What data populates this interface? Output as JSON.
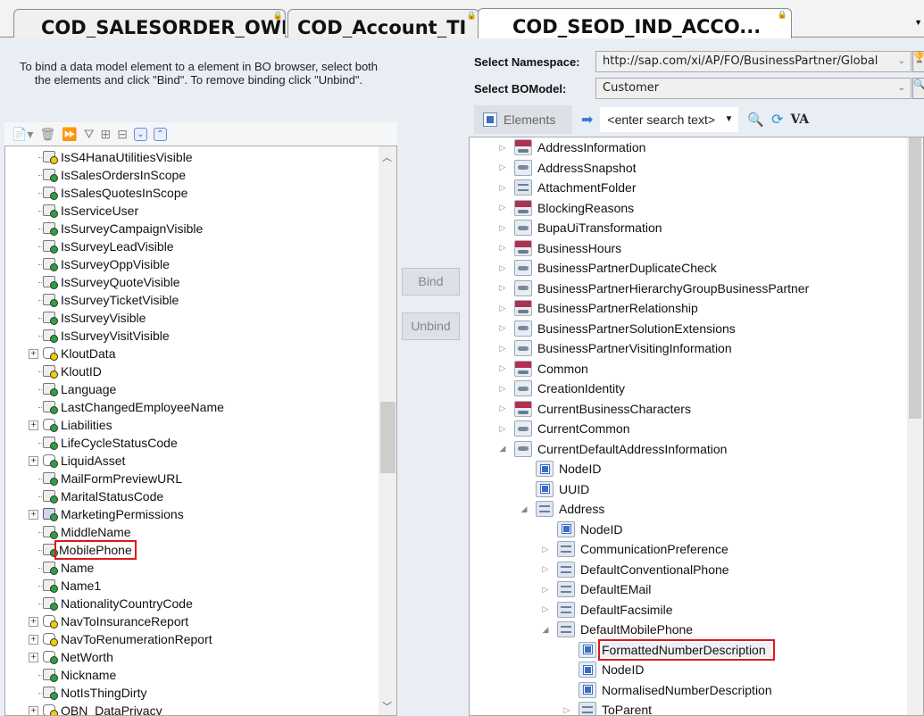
{
  "tabs": [
    {
      "label": "COD_SALESORDER_OWL",
      "locked": true
    },
    {
      "label": "COD_Account_TI",
      "locked": true
    },
    {
      "label": "COD_SEOD_IND_ACCO...",
      "locked": true,
      "active": true
    }
  ],
  "instructions": "To bind a data model element to a element in BO browser, select both the elements and click \"Bind\". To remove binding click \"Unbind\".",
  "buttons": {
    "bind": "Bind",
    "unbind": "Unbind"
  },
  "namespace": {
    "label": "Select Namespace:",
    "value": "http://sap.com/xi/AP/FO/BusinessPartner/Global"
  },
  "bomodel": {
    "label": "Select BOModel:",
    "value": "Customer"
  },
  "elements_button": "Elements",
  "search": {
    "placeholder": "<enter search text>"
  },
  "va_label": "VA",
  "left_tree": [
    {
      "name": "IsS4HanaUtilitiesVisible",
      "icon": "field",
      "status": "yellow"
    },
    {
      "name": "IsSalesOrdersInScope",
      "icon": "field",
      "status": "green"
    },
    {
      "name": "IsSalesQuotesInScope",
      "icon": "field",
      "status": "green"
    },
    {
      "name": "IsServiceUser",
      "icon": "field",
      "status": "green"
    },
    {
      "name": "IsSurveyCampaignVisible",
      "icon": "field",
      "status": "green"
    },
    {
      "name": "IsSurveyLeadVisible",
      "icon": "field",
      "status": "green"
    },
    {
      "name": "IsSurveyOppVisible",
      "icon": "field",
      "status": "green"
    },
    {
      "name": "IsSurveyQuoteVisible",
      "icon": "field",
      "status": "green"
    },
    {
      "name": "IsSurveyTicketVisible",
      "icon": "field",
      "status": "green"
    },
    {
      "name": "IsSurveyVisible",
      "icon": "field",
      "status": "green"
    },
    {
      "name": "IsSurveyVisitVisible",
      "icon": "field",
      "status": "green"
    },
    {
      "name": "KloutData",
      "icon": "node",
      "status": "yellow",
      "expandable": true
    },
    {
      "name": "KloutID",
      "icon": "field",
      "status": "yellow"
    },
    {
      "name": "Language",
      "icon": "field",
      "status": "green"
    },
    {
      "name": "LastChangedEmployeeName",
      "icon": "field",
      "status": "green"
    },
    {
      "name": "Liabilities",
      "icon": "node",
      "status": "green",
      "expandable": true
    },
    {
      "name": "LifeCycleStatusCode",
      "icon": "field",
      "status": "green"
    },
    {
      "name": "LiquidAsset",
      "icon": "node",
      "status": "green",
      "expandable": true
    },
    {
      "name": "MailFormPreviewURL",
      "icon": "field",
      "status": "green"
    },
    {
      "name": "MaritalStatusCode",
      "icon": "field",
      "status": "green"
    },
    {
      "name": "MarketingPermissions",
      "icon": "table",
      "status": "green",
      "expandable": true
    },
    {
      "name": "MiddleName",
      "icon": "field",
      "status": "green"
    },
    {
      "name": "MobilePhone",
      "icon": "field",
      "status": "green",
      "highlighted": true
    },
    {
      "name": "Name",
      "icon": "field",
      "status": "green"
    },
    {
      "name": "Name1",
      "icon": "field",
      "status": "green"
    },
    {
      "name": "NationalityCountryCode",
      "icon": "field",
      "status": "green"
    },
    {
      "name": "NavToInsuranceReport",
      "icon": "node",
      "status": "yellow",
      "expandable": true
    },
    {
      "name": "NavToRenumerationReport",
      "icon": "node",
      "status": "yellow",
      "expandable": true
    },
    {
      "name": "NetWorth",
      "icon": "node",
      "status": "green",
      "expandable": true
    },
    {
      "name": "Nickname",
      "icon": "field",
      "status": "green"
    },
    {
      "name": "NotIsThingDirty",
      "icon": "field",
      "status": "green"
    },
    {
      "name": "OBN_DataPrivacy",
      "icon": "node",
      "status": "yellow",
      "expandable": true
    }
  ],
  "right_tree": [
    {
      "name": "AddressInformation",
      "depth": 0,
      "expander": "collapsed",
      "icon": "assoc-red"
    },
    {
      "name": "AddressSnapshot",
      "depth": 0,
      "expander": "collapsed",
      "icon": "assoc"
    },
    {
      "name": "AttachmentFolder",
      "depth": 0,
      "expander": "collapsed",
      "icon": "node"
    },
    {
      "name": "BlockingReasons",
      "depth": 0,
      "expander": "collapsed",
      "icon": "assoc-red"
    },
    {
      "name": "BupaUiTransformation",
      "depth": 0,
      "expander": "collapsed",
      "icon": "assoc"
    },
    {
      "name": "BusinessHours",
      "depth": 0,
      "expander": "collapsed",
      "icon": "assoc-red"
    },
    {
      "name": "BusinessPartnerDuplicateCheck",
      "depth": 0,
      "expander": "collapsed",
      "icon": "assoc"
    },
    {
      "name": "BusinessPartnerHierarchyGroupBusinessPartner",
      "depth": 0,
      "expander": "collapsed",
      "icon": "assoc"
    },
    {
      "name": "BusinessPartnerRelationship",
      "depth": 0,
      "expander": "collapsed",
      "icon": "assoc-red"
    },
    {
      "name": "BusinessPartnerSolutionExtensions",
      "depth": 0,
      "expander": "collapsed",
      "icon": "assoc"
    },
    {
      "name": "BusinessPartnerVisitingInformation",
      "depth": 0,
      "expander": "collapsed",
      "icon": "assoc"
    },
    {
      "name": "Common",
      "depth": 0,
      "expander": "collapsed",
      "icon": "assoc-red"
    },
    {
      "name": "CreationIdentity",
      "depth": 0,
      "expander": "collapsed",
      "icon": "assoc"
    },
    {
      "name": "CurrentBusinessCharacters",
      "depth": 0,
      "expander": "collapsed",
      "icon": "assoc-red"
    },
    {
      "name": "CurrentCommon",
      "depth": 0,
      "expander": "collapsed",
      "icon": "assoc"
    },
    {
      "name": "CurrentDefaultAddressInformation",
      "depth": 0,
      "expander": "expanded",
      "icon": "assoc"
    },
    {
      "name": "NodeID",
      "depth": 1,
      "expander": "none",
      "icon": "element"
    },
    {
      "name": "UUID",
      "depth": 1,
      "expander": "none",
      "icon": "element"
    },
    {
      "name": "Address",
      "depth": 1,
      "expander": "expanded",
      "icon": "node"
    },
    {
      "name": "NodeID",
      "depth": 2,
      "expander": "none",
      "icon": "element"
    },
    {
      "name": "CommunicationPreference",
      "depth": 2,
      "expander": "collapsed",
      "icon": "node"
    },
    {
      "name": "DefaultConventionalPhone",
      "depth": 2,
      "expander": "collapsed",
      "icon": "node"
    },
    {
      "name": "DefaultEMail",
      "depth": 2,
      "expander": "collapsed",
      "icon": "node"
    },
    {
      "name": "DefaultFacsimile",
      "depth": 2,
      "expander": "collapsed",
      "icon": "node"
    },
    {
      "name": "DefaultMobilePhone",
      "depth": 2,
      "expander": "expanded",
      "icon": "node"
    },
    {
      "name": "FormattedNumberDescription",
      "depth": 3,
      "expander": "none",
      "icon": "element",
      "highlighted": true
    },
    {
      "name": "NodeID",
      "depth": 3,
      "expander": "none",
      "icon": "element"
    },
    {
      "name": "NormalisedNumberDescription",
      "depth": 3,
      "expander": "none",
      "icon": "element"
    },
    {
      "name": "ToParent",
      "depth": 3,
      "expander": "collapsed",
      "icon": "node"
    }
  ]
}
